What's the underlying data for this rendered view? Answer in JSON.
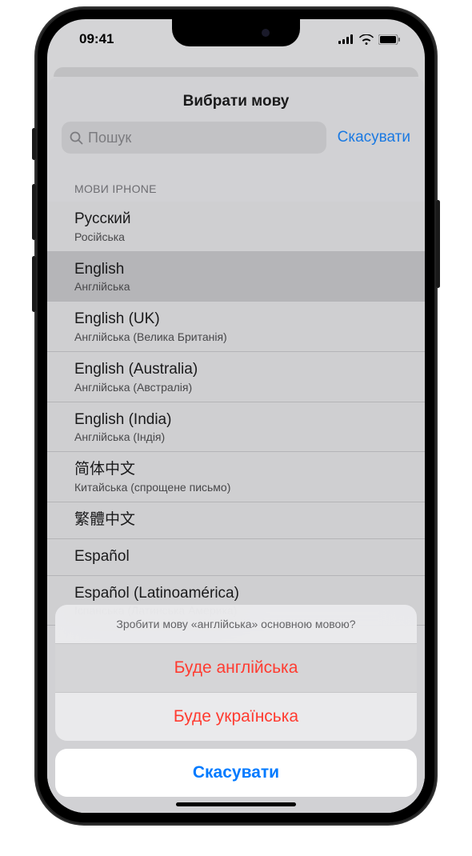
{
  "status": {
    "time": "09:41"
  },
  "sheet": {
    "title": "Вибрати мову",
    "search_placeholder": "Пошук",
    "search_cancel": "Скасувати",
    "section_header": "МОВИ IPHONE",
    "languages": [
      {
        "native": "Русский",
        "sub": "Російська",
        "selected": false
      },
      {
        "native": "English",
        "sub": "Англійська",
        "selected": true
      },
      {
        "native": "English (UK)",
        "sub": "Англійська (Велика Британія)",
        "selected": false
      },
      {
        "native": "English (Australia)",
        "sub": "Англійська (Австралія)",
        "selected": false
      },
      {
        "native": "English (India)",
        "sub": "Англійська (Індія)",
        "selected": false
      },
      {
        "native": "简体中文",
        "sub": "Китайська (спрощене письмо)",
        "selected": false
      },
      {
        "native": "繁體中文",
        "sub": "",
        "selected": false
      },
      {
        "native": "Español",
        "sub": "",
        "selected": false
      },
      {
        "native": "Español (Latinoamérica)",
        "sub": "Іспанська (Латинська Америка)",
        "selected": false
      }
    ]
  },
  "action_sheet": {
    "title": "Зробити мову «англійська» основною мовою?",
    "options": [
      {
        "label": "Буде англійська",
        "highlighted": true
      },
      {
        "label": "Буде українська",
        "highlighted": false
      }
    ],
    "cancel": "Скасувати"
  }
}
